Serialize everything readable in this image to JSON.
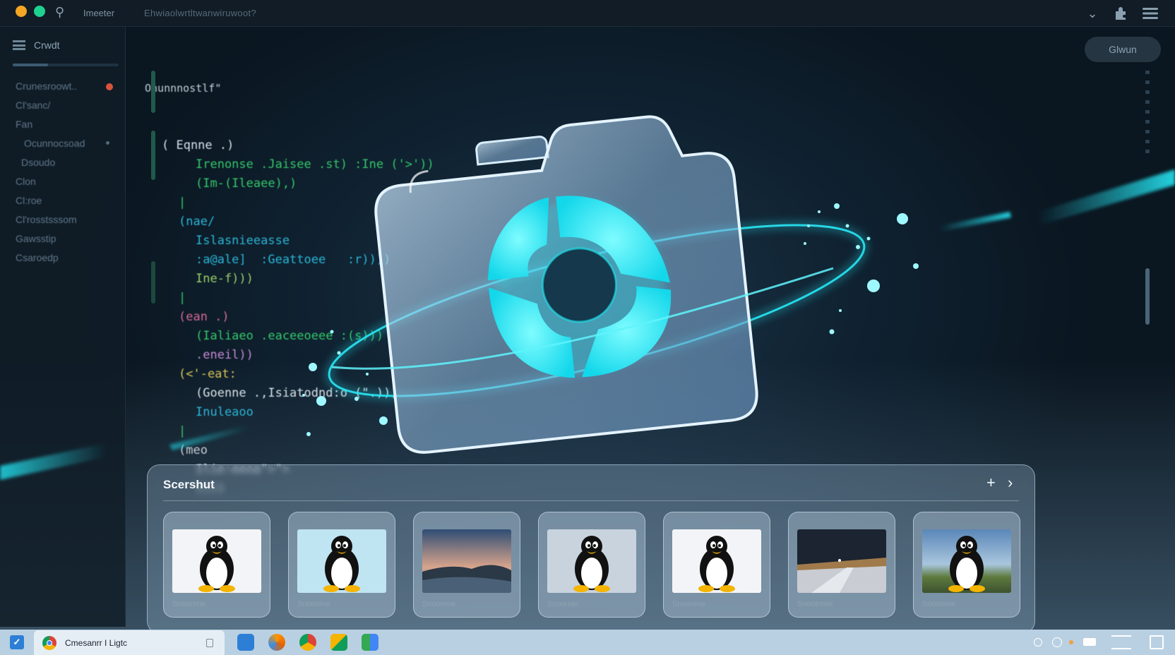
{
  "window": {
    "app_name": "Imeeter",
    "path": "Ehwiaolwrtltwanwiruwoot?",
    "controls": [
      "chevron-down-icon",
      "extension-icon",
      "menu-icon"
    ]
  },
  "sidebar": {
    "header_label": "Crwdt",
    "items": [
      {
        "label": "Crunesroowt..",
        "badge": true
      },
      {
        "label": "Cl'sanc/"
      },
      {
        "label": "Fan"
      },
      {
        "label": "Ocunnocsoad",
        "badge": false
      },
      {
        "label": "Dsoudo"
      },
      {
        "label": "Clon"
      },
      {
        "label": "Cl:roe"
      },
      {
        "label": "Cl'rosstsssom"
      },
      {
        "label": "Gawsstip"
      },
      {
        "label": "Csaroedp"
      }
    ]
  },
  "editor": {
    "header": "Onunnnostlf\"",
    "lines": [
      {
        "indent": 1,
        "text": "( Eqnne .)",
        "color": "#d9e3ea"
      },
      {
        "indent": 3,
        "text": "Irenonse .Jaisee .st) :Ine ('>'))",
        "color": "#34c86a"
      },
      {
        "indent": 3,
        "text": "(Im-(Ileaee),)",
        "color": "#34c86a"
      },
      {
        "indent": 2,
        "text": "|",
        "color": "#34c86a"
      },
      {
        "indent": 2,
        "text": "(nae/",
        "color": "#2bb7d8"
      },
      {
        "indent": 3,
        "text": "Islasnieeasse",
        "color": "#2bb7d8"
      },
      {
        "indent": 3,
        "text": ":a@ale]  :Geattoee   :r))))",
        "color": "#2bb7d8"
      },
      {
        "indent": 3,
        "text": "Ine-f)))",
        "color": "#9bd06a"
      },
      {
        "indent": 2,
        "text": "|",
        "color": "#34c86a"
      },
      {
        "indent": 2,
        "text": "(ean .)",
        "color": "#d86a9a"
      },
      {
        "indent": 3,
        "text": "(Ialiaeo .eaceeoeee :(s)))",
        "color": "#34c86a"
      },
      {
        "indent": 3,
        "text": ".eneil))",
        "color": "#c98ad6"
      },
      {
        "indent": 2,
        "text": "(<'-eat:",
        "color": "#d9c45a"
      },
      {
        "indent": 3,
        "text": "(Goenne .,Isiatodnd:o (\".)))",
        "color": "#d9e3ea"
      },
      {
        "indent": 3,
        "text": "Inuleaoo",
        "color": "#2bb7d8"
      },
      {
        "indent": 2,
        "text": "|",
        "color": "#34c86a"
      },
      {
        "indent": 2,
        "text": "(meo",
        "color": "#c8cfd6"
      },
      {
        "indent": 3,
        "text": "Ilie:eeoa\">\">",
        "color": "#c8cfd6"
      },
      {
        "indent": 3,
        "text": "()))",
        "color": "#c8cfd6"
      }
    ]
  },
  "right_button": {
    "label": "Glwun"
  },
  "screenshot_panel": {
    "title": "Scershut",
    "add_icon": "plus-icon",
    "next_icon": "chevron-right-icon",
    "thumbnails": [
      {
        "kind": "penguin",
        "bg": "#f2f4f7",
        "caption": "Snoonme"
      },
      {
        "kind": "penguin",
        "bg": "#bfe4f2",
        "caption": "Snoonme"
      },
      {
        "kind": "landscape-sunset",
        "caption": "Snoonme"
      },
      {
        "kind": "penguin",
        "bg": "#c9d3de",
        "caption": "Snoomer"
      },
      {
        "kind": "penguin",
        "bg": "#f2f4f7",
        "caption": "Snoonme"
      },
      {
        "kind": "road",
        "caption": "Snootmen"
      },
      {
        "kind": "penguin-landscape",
        "caption": "Snoonme"
      }
    ]
  },
  "taskbar": {
    "start_icon": "start-icon",
    "tab_label": "Cmesanrr I Ligtc",
    "apps": [
      "files-icon",
      "firefox-icon",
      "chrome-icon",
      "photos-icon",
      "blocks-icon"
    ],
    "tray": [
      "circle-icon",
      "circle-icon",
      "dot-icon",
      "battery-icon",
      "lines-icon",
      "square-icon"
    ]
  },
  "colors": {
    "accent": "#1ee6f0",
    "camera_glass": "#9fc8ea",
    "bg_dark": "#0b1620"
  }
}
